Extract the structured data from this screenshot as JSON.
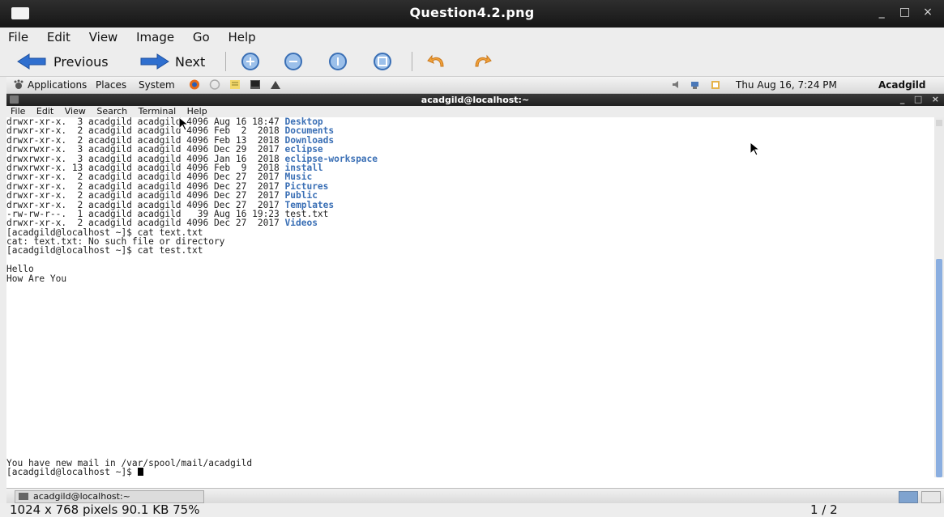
{
  "viewer": {
    "title": "Question4.2.png",
    "window_controls": [
      "_",
      "□",
      "×"
    ],
    "menu": [
      "File",
      "Edit",
      "View",
      "Image",
      "Go",
      "Help"
    ],
    "toolbar": {
      "previous_label": "Previous",
      "next_label": "Next",
      "zoom_icons": [
        "zoom-in-icon",
        "zoom-out-icon",
        "zoom-normal-icon",
        "zoom-fit-icon"
      ],
      "rotate_icons": [
        "rotate-left-icon",
        "rotate-right-icon"
      ]
    },
    "status": {
      "info": "1024 x 768 pixels  90.1 KB   75%",
      "page": "1 / 2"
    }
  },
  "desktop": {
    "panel": {
      "applications": "Applications",
      "places": "Places",
      "system": "System",
      "datetime": "Thu Aug 16,  7:24 PM",
      "user": "Acadgild"
    },
    "terminal": {
      "title": "acadgild@localhost:~",
      "controls": [
        "_",
        "□",
        "×"
      ],
      "menu": [
        "File",
        "Edit",
        "View",
        "Search",
        "Terminal",
        "Help"
      ],
      "listing": [
        {
          "prefix": "drwxr-xr-x.  3 acadgild acadgild 4096 Aug 16 18:47 ",
          "name": "Desktop",
          "dir": true
        },
        {
          "prefix": "drwxr-xr-x.  2 acadgild acadgild 4096 Feb  2  2018 ",
          "name": "Documents",
          "dir": true
        },
        {
          "prefix": "drwxr-xr-x.  2 acadgild acadgild 4096 Feb 13  2018 ",
          "name": "Downloads",
          "dir": true
        },
        {
          "prefix": "drwxrwxr-x.  3 acadgild acadgild 4096 Dec 29  2017 ",
          "name": "eclipse",
          "dir": true
        },
        {
          "prefix": "drwxrwxr-x.  3 acadgild acadgild 4096 Jan 16  2018 ",
          "name": "eclipse-workspace",
          "dir": true
        },
        {
          "prefix": "drwxrwxr-x. 13 acadgild acadgild 4096 Feb  9  2018 ",
          "name": "install",
          "dir": true
        },
        {
          "prefix": "drwxr-xr-x.  2 acadgild acadgild 4096 Dec 27  2017 ",
          "name": "Music",
          "dir": true
        },
        {
          "prefix": "drwxr-xr-x.  2 acadgild acadgild 4096 Dec 27  2017 ",
          "name": "Pictures",
          "dir": true
        },
        {
          "prefix": "drwxr-xr-x.  2 acadgild acadgild 4096 Dec 27  2017 ",
          "name": "Public",
          "dir": true
        },
        {
          "prefix": "drwxr-xr-x.  2 acadgild acadgild 4096 Dec 27  2017 ",
          "name": "Templates",
          "dir": true
        },
        {
          "prefix": "-rw-rw-r--.  1 acadgild acadgild   39 Aug 16 19:23 ",
          "name": "test.txt",
          "dir": false
        },
        {
          "prefix": "drwxr-xr-x.  2 acadgild acadgild 4096 Dec 27  2017 ",
          "name": "Videos",
          "dir": true
        }
      ],
      "after_lines": [
        "[acadgild@localhost ~]$ cat text.txt",
        "cat: text.txt: No such file or directory",
        "[acadgild@localhost ~]$ cat test.txt",
        "",
        "Hello",
        "How Are You"
      ],
      "mail_notice": "You have new mail in /var/spool/mail/acadgild",
      "prompt": "[acadgild@localhost ~]$ "
    },
    "taskbar": {
      "task_label": "acadgild@localhost:~"
    }
  },
  "colors": {
    "dir_blue": "#3a6fb5",
    "title_dark": "#1c1c1c",
    "scroll_thumb": "#8aaee0"
  }
}
